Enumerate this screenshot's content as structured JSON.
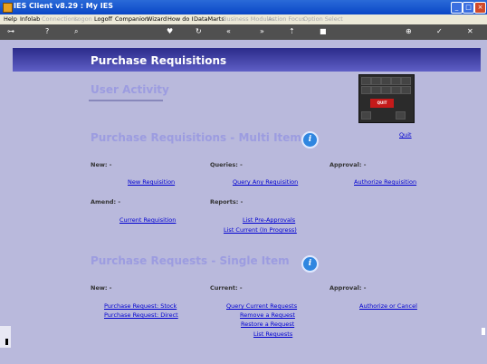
{
  "window": {
    "title": "IES Client v8.29 : My IES"
  },
  "menu": [
    {
      "label": "Help",
      "enabled": true
    },
    {
      "label": "Infolab",
      "enabled": true
    },
    {
      "label": "Connections",
      "enabled": false
    },
    {
      "label": "Logon",
      "enabled": false
    },
    {
      "label": "Logoff",
      "enabled": true
    },
    {
      "label": "Companion",
      "enabled": true
    },
    {
      "label": "Wizard",
      "enabled": true
    },
    {
      "label": "How do I",
      "enabled": true
    },
    {
      "label": "DataMarts",
      "enabled": true
    },
    {
      "label": "Business Modules",
      "enabled": false
    },
    {
      "label": "Action Focus",
      "enabled": false
    },
    {
      "label": "Option Select",
      "enabled": false
    }
  ],
  "toolbar_icons": [
    "key-icon",
    "help-icon",
    "search-icon",
    "heart-icon",
    "refresh-icon",
    "back-icon",
    "forward-icon",
    "upload-icon",
    "stop-icon",
    "add-icon",
    "check-icon",
    "close-icon"
  ],
  "page": {
    "banner_title": "Purchase Requisitions",
    "user_activity": "User Activity",
    "keyboard_key_text": "QUIT",
    "quit_link": "Quit"
  },
  "section1": {
    "title": "Purchase Requisitions - Multi Item",
    "new_label": "New: -",
    "queries_label": "Queries: -",
    "approval_label": "Approval: -",
    "new_requisition": "New Requisition",
    "query_any_requisition": "Query Any Requisition",
    "authorize_requisition": "Authorize Requisition",
    "amend_label": "Amend: -",
    "reports_label": "Reports: -",
    "current_requisition": "Current Requisition",
    "list_pre_approvals": "List Pre-Approvals",
    "list_current_in_progress": "List Current (In Progress)"
  },
  "section2": {
    "title": "Purchase Requests - Single Item",
    "new_label": "New: -",
    "current_label": "Current: -",
    "approval_label": "Approval: -",
    "purchase_request_stock": "Purchase Request: Stock",
    "purchase_request_direct": "Purchase Request: Direct",
    "query_current_requests": "Query Current Requests",
    "remove_a_request": "Remove a Request",
    "restore_a_request": "Restore a Request",
    "list_requests": "List Requests",
    "authorize_or_cancel": "Authorize or Cancel"
  }
}
